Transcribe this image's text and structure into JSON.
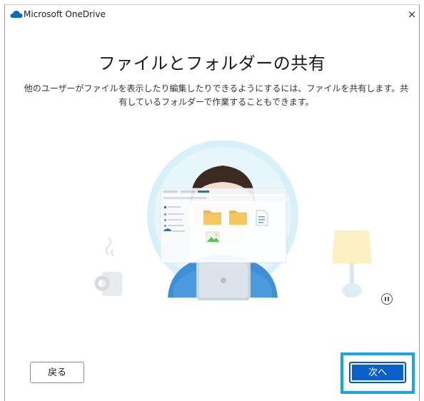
{
  "window": {
    "title": "Microsoft OneDrive",
    "close_glyph": "×"
  },
  "content": {
    "heading": "ファイルとフォルダーの共有",
    "description": "他のユーザーがファイルを表示したり編集したりできるようにするには、ファイルを共有します。共有しているフォルダーで作業することもできます。"
  },
  "footer": {
    "back_label": "戻る",
    "next_label": "次へ"
  },
  "colors": {
    "accent": "#0c5fc7",
    "highlight_border": "#1aa6e0",
    "circle_bg": "#d8f0f8",
    "folder": "#f4c75a",
    "shirt": "#3f8fd6"
  },
  "icons": {
    "app": "onedrive-cloud-icon",
    "close": "close-icon",
    "pause": "pause-icon"
  }
}
